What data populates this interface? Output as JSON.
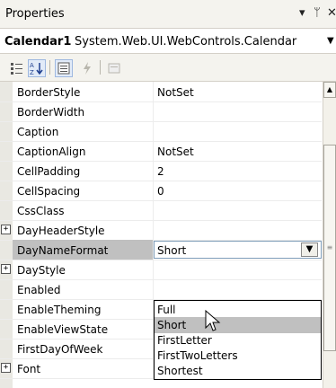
{
  "panel": {
    "title": "Properties",
    "pin_icon": "▾",
    "autohide_icon": "ᛘ",
    "close_icon": "✕"
  },
  "object_bar": {
    "name": "Calendar1",
    "type": "System.Web.UI.WebControls.Calendar"
  },
  "toolbar": {
    "categorized_icon": "categorized-icon",
    "alphabetical_icon": "alphabetical-icon",
    "properties_icon": "properties-icon",
    "events_icon": "events-icon",
    "pages_icon": "property-pages-icon"
  },
  "grid": {
    "rows": [
      {
        "name": "BorderStyle",
        "value": "NotSet"
      },
      {
        "name": "BorderWidth",
        "value": ""
      },
      {
        "name": "Caption",
        "value": ""
      },
      {
        "name": "CaptionAlign",
        "value": "NotSet"
      },
      {
        "name": "CellPadding",
        "value": "2"
      },
      {
        "name": "CellSpacing",
        "value": "0"
      },
      {
        "name": "CssClass",
        "value": ""
      },
      {
        "name": "DayHeaderStyle",
        "value": "",
        "expandable": true
      },
      {
        "name": "DayNameFormat",
        "value": "Short",
        "selected": true
      },
      {
        "name": "DayStyle",
        "value": "",
        "expandable": true
      },
      {
        "name": "Enabled",
        "value": ""
      },
      {
        "name": "EnableTheming",
        "value": ""
      },
      {
        "name": "EnableViewState",
        "value": ""
      },
      {
        "name": "FirstDayOfWeek",
        "value": ""
      },
      {
        "name": "Font",
        "value": "",
        "expandable": true
      }
    ],
    "expander_glyph": "+"
  },
  "dropdown": {
    "options": [
      "Full",
      "Short",
      "FirstLetter",
      "FirstTwoLetters",
      "Shortest"
    ],
    "highlighted_index": 1
  },
  "colors": {
    "panel_bg": "#f4f3ee",
    "selection_gray": "#c0c0c0",
    "margin_bg": "#e9e8e2"
  }
}
